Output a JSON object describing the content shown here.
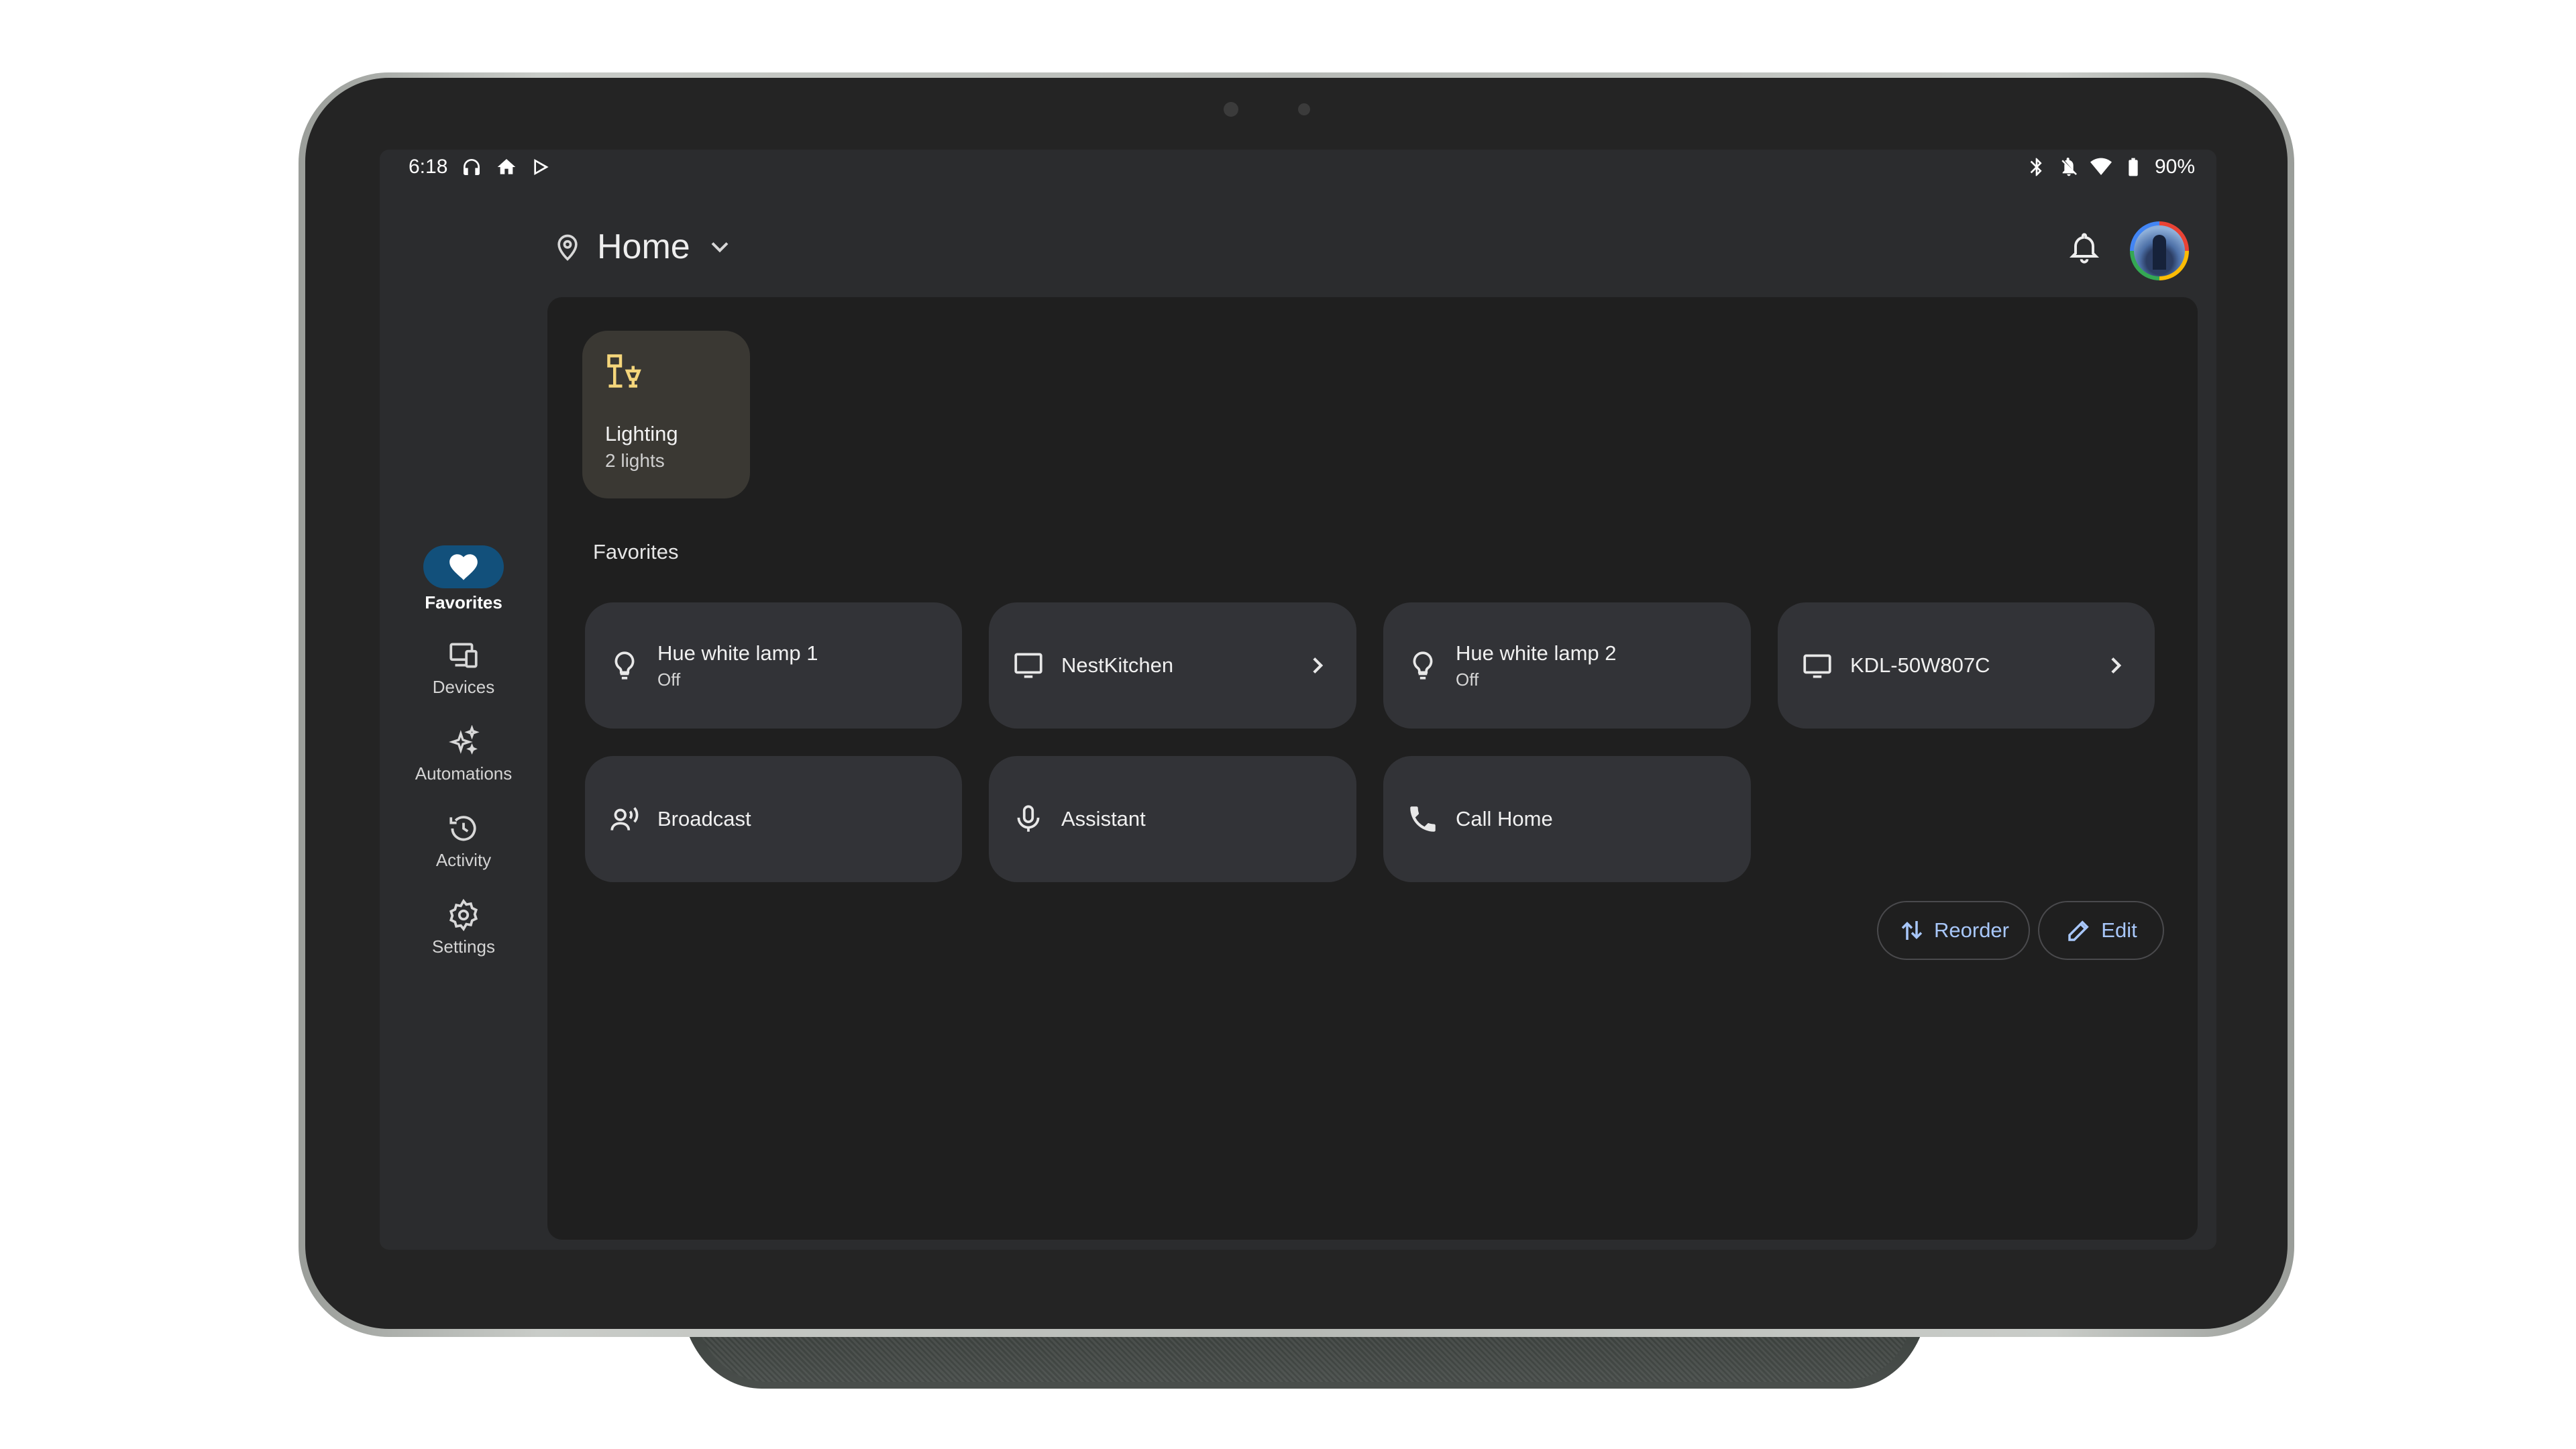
{
  "status_bar": {
    "time": "6:18",
    "left_icons": [
      "headphones-icon",
      "home-icon",
      "play-store-icon"
    ],
    "right_icons": [
      "bluetooth-icon",
      "notifications-off-icon",
      "wifi-icon",
      "battery-icon"
    ],
    "battery": "90%"
  },
  "header": {
    "home_name": "Home"
  },
  "nav": {
    "items": [
      {
        "label": "Favorites",
        "icon": "heart-icon",
        "active": true
      },
      {
        "label": "Devices",
        "icon": "devices-icon",
        "active": false
      },
      {
        "label": "Automations",
        "icon": "sparkle-icon",
        "active": false
      },
      {
        "label": "Activity",
        "icon": "history-icon",
        "active": false
      },
      {
        "label": "Settings",
        "icon": "gear-icon",
        "active": false
      }
    ]
  },
  "lighting_card": {
    "title": "Lighting",
    "subtitle": "2 lights",
    "icon": "lamp-icon"
  },
  "favorites": {
    "title": "Favorites",
    "tiles": [
      {
        "name": "Hue white lamp 1",
        "state": "Off",
        "icon": "bulb-icon"
      },
      {
        "name": "NestKitchen",
        "icon": "display-icon"
      },
      {
        "name": "Hue white lamp 2",
        "state": "Off",
        "icon": "bulb-icon"
      },
      {
        "name": "KDL-50W807C",
        "icon": "tv-icon"
      },
      {
        "name": "Broadcast",
        "icon": "broadcast-icon"
      },
      {
        "name": "Assistant",
        "icon": "mic-icon"
      },
      {
        "name": "Call Home",
        "icon": "phone-icon"
      }
    ]
  },
  "actions": {
    "reorder": "Reorder",
    "edit": "Edit"
  },
  "colors": {
    "screen_bg": "#2b2c2e",
    "panel_bg": "#1f1f1f",
    "tile_bg": "#323337",
    "accent": "#a8c7fa",
    "nav_active": "#12507b",
    "lighting_icon": "#f5d67b"
  }
}
